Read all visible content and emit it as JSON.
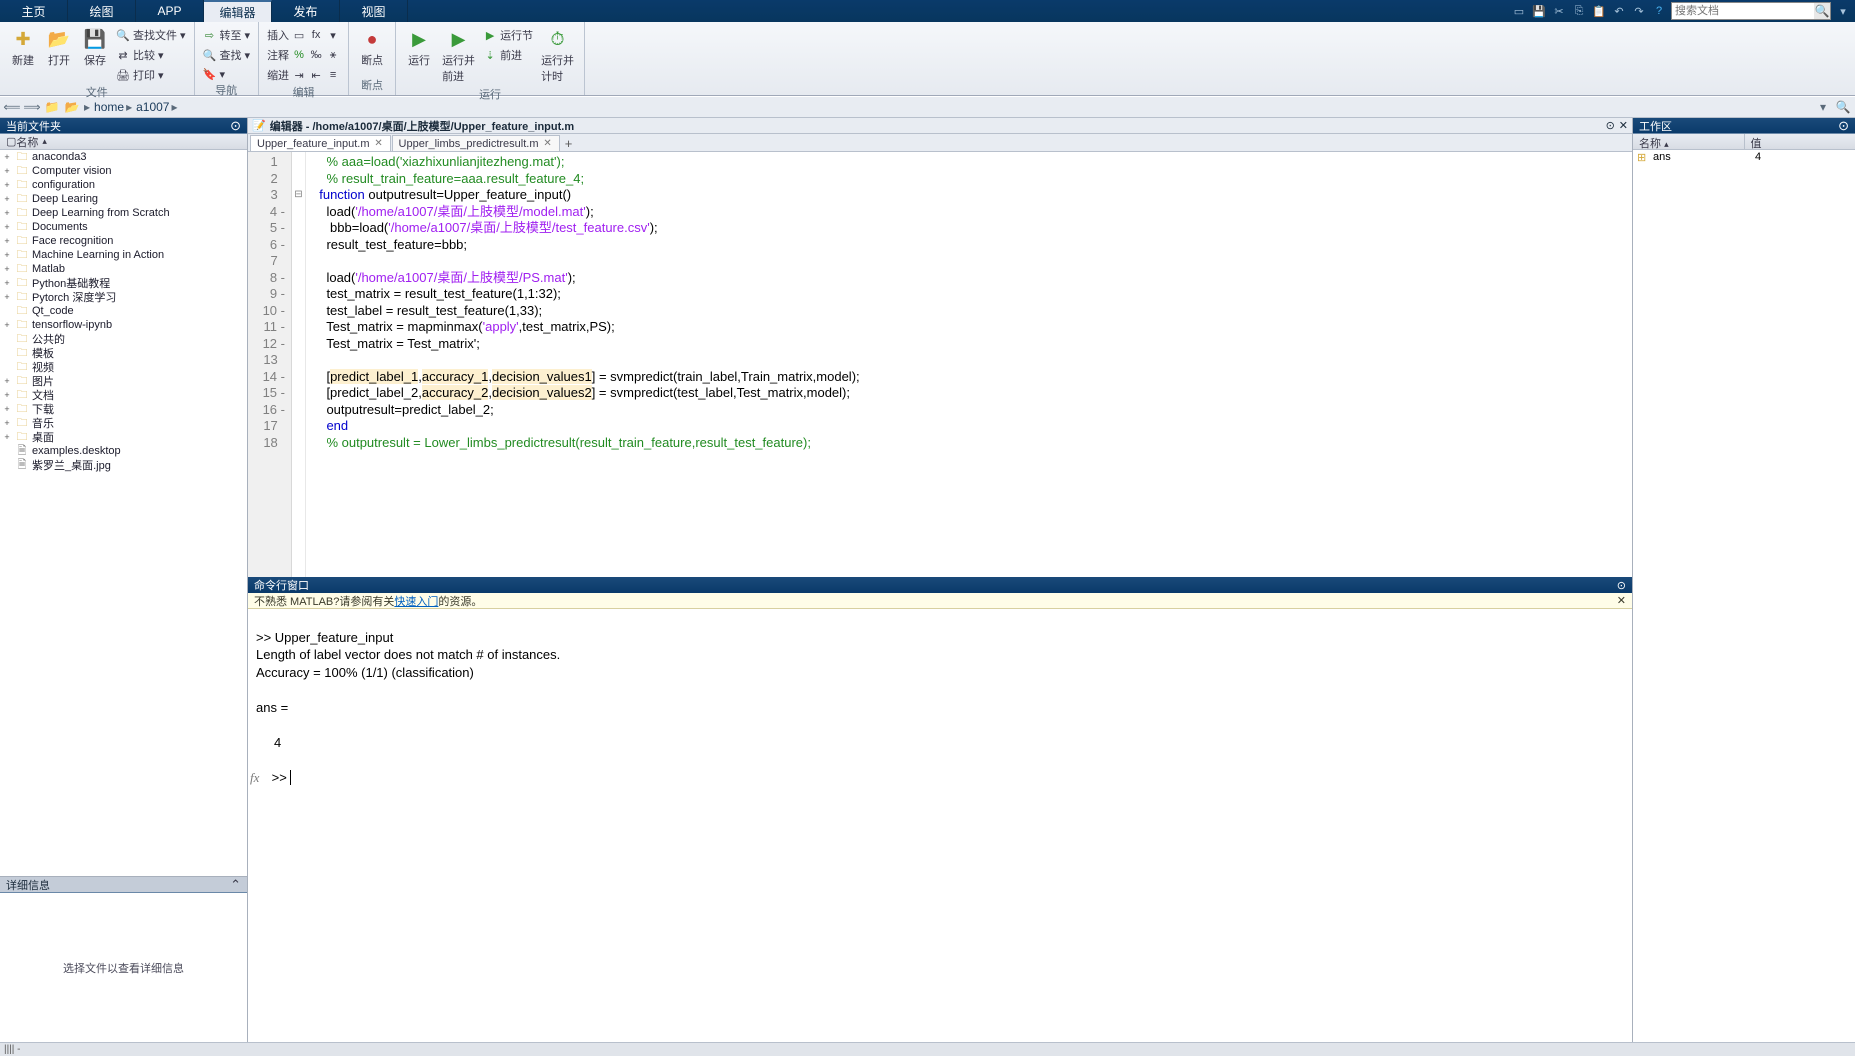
{
  "menu": {
    "tabs": [
      "主页",
      "绘图",
      "APP",
      "编辑器",
      "发布",
      "视图"
    ],
    "active_index": 3,
    "search_placeholder": "搜索文档"
  },
  "toolstrip": {
    "file": {
      "new": "新建",
      "open": "打开",
      "save": "保存",
      "find_files": "查找文件",
      "compare": "比较",
      "print": "打印",
      "label": "文件"
    },
    "nav": {
      "goto": "转至",
      "find": "查找",
      "bookmark": "",
      "label": "导航"
    },
    "edit": {
      "insert": "插入",
      "comment": "注释",
      "indent": "缩进",
      "label": "编辑"
    },
    "bp": {
      "breakpoints": "断点",
      "label": "断点"
    },
    "run": {
      "run": "运行",
      "run_advance": "运行并\n前进",
      "run_section": "运行节",
      "advance": "前进",
      "run_time": "运行并\n计时",
      "label": "运行"
    }
  },
  "address": {
    "parts": [
      "home",
      "a1007"
    ]
  },
  "current_folder": {
    "title": "当前文件夹",
    "name_col": "名称",
    "items": [
      {
        "t": "folder",
        "n": "anaconda3",
        "e": "+"
      },
      {
        "t": "folder",
        "n": "Computer vision",
        "e": "+"
      },
      {
        "t": "folder",
        "n": "configuration",
        "e": "+"
      },
      {
        "t": "folder",
        "n": "Deep Learing",
        "e": "+"
      },
      {
        "t": "folder",
        "n": "Deep Learning from Scratch",
        "e": "+"
      },
      {
        "t": "folder",
        "n": "Documents",
        "e": "+"
      },
      {
        "t": "folder",
        "n": "Face recognition",
        "e": "+"
      },
      {
        "t": "folder",
        "n": "Machine Learning in Action",
        "e": "+"
      },
      {
        "t": "folder",
        "n": "Matlab",
        "e": "+"
      },
      {
        "t": "folder",
        "n": "Python基础教程",
        "e": "+"
      },
      {
        "t": "folder",
        "n": "Pytorch 深度学习",
        "e": "+"
      },
      {
        "t": "folder",
        "n": "Qt_code",
        "e": ""
      },
      {
        "t": "folder",
        "n": "tensorflow-ipynb",
        "e": "+"
      },
      {
        "t": "folder",
        "n": "公共的",
        "e": ""
      },
      {
        "t": "folder",
        "n": "模板",
        "e": ""
      },
      {
        "t": "folder",
        "n": "视频",
        "e": ""
      },
      {
        "t": "folder",
        "n": "图片",
        "e": "+"
      },
      {
        "t": "folder",
        "n": "文档",
        "e": "+"
      },
      {
        "t": "folder",
        "n": "下载",
        "e": "+"
      },
      {
        "t": "folder",
        "n": "音乐",
        "e": "+"
      },
      {
        "t": "folder",
        "n": "桌面",
        "e": "+"
      },
      {
        "t": "file",
        "n": "examples.desktop",
        "e": ""
      },
      {
        "t": "file",
        "n": "紫罗兰_桌面.jpg",
        "e": ""
      }
    ]
  },
  "details": {
    "title": "详细信息",
    "empty": "选择文件以查看详细信息"
  },
  "editor": {
    "title_prefix": "编辑器 - ",
    "path": "/home/a1007/桌面/上肢模型/Upper_feature_input.m",
    "tabs": [
      {
        "label": "Upper_feature_input.m",
        "active": true
      },
      {
        "label": "Upper_limbs_predictresult.m",
        "active": false
      }
    ],
    "lines": [
      {
        "n": 1,
        "html": "    <span class='c-comment'>% aaa=load('xiazhixunlianjitezheng.mat');</span>"
      },
      {
        "n": 2,
        "html": "    <span class='c-comment'>% result_train_feature=aaa.result_feature_4;</span>"
      },
      {
        "n": 3,
        "fold": "⊟",
        "html": "  <span class='c-keyword'>function</span> outputresult=Upper_feature_input()"
      },
      {
        "n": 4,
        "dash": true,
        "html": "    load(<span class='c-string'>'/home/a1007/桌面/上肢模型/model.mat'</span>);"
      },
      {
        "n": 5,
        "dash": true,
        "html": "     bbb=load(<span class='c-string'>'/home/a1007/桌面/上肢模型/test_feature.csv'</span>);"
      },
      {
        "n": 6,
        "dash": true,
        "html": "    result_test_feature=bbb;"
      },
      {
        "n": 7,
        "html": ""
      },
      {
        "n": 8,
        "dash": true,
        "html": "    load(<span class='c-string'>'/home/a1007/桌面/上肢模型/PS.mat'</span>);"
      },
      {
        "n": 9,
        "dash": true,
        "html": "    test_matrix = result_test_feature(1,1:32);"
      },
      {
        "n": 10,
        "dash": true,
        "html": "    test_label = result_test_feature(1,33);"
      },
      {
        "n": 11,
        "dash": true,
        "html": "    Test_matrix = mapminmax(<span class='c-string'>'apply'</span>,test_matrix,PS);"
      },
      {
        "n": 12,
        "dash": true,
        "html": "    Test_matrix = Test_matrix';"
      },
      {
        "n": 13,
        "html": ""
      },
      {
        "n": 14,
        "dash": true,
        "html": "    [<span class='c-hl'>predict_label_1</span>,<span class='c-hl'>accuracy_1</span>,<span class='c-hl'>decision_values1</span>] = svmpredict(train_label,Train_matrix,model);"
      },
      {
        "n": 15,
        "dash": true,
        "html": "    [predict_label_2,<span class='c-hl'>accuracy_2</span>,<span class='c-hl'>decision_values2</span>] = svmpredict(test_label,Test_matrix,model);"
      },
      {
        "n": 16,
        "dash": true,
        "html": "    outputresult=predict_label_2;"
      },
      {
        "n": 17,
        "html": "    <span class='c-keyword'>end</span>"
      },
      {
        "n": 18,
        "html": "    <span class='c-comment'>% outputresult = Lower_limbs_predictresult(result_train_feature,result_test_feature);</span>"
      }
    ]
  },
  "command_window": {
    "title": "命令行窗口",
    "hint_prefix": "不熟悉 MATLAB?请参阅有关",
    "hint_link": "快速入门",
    "hint_suffix": "的资源。",
    "output": ">> Upper_feature_input\nLength of label vector does not match # of instances.\nAccuracy = 100% (1/1) (classification)\n\nans =\n\n     4\n\n",
    "prompt": ">> ",
    "fx": "fx"
  },
  "workspace": {
    "title": "工作区",
    "col_name": "名称",
    "col_value": "值",
    "vars": [
      {
        "name": "ans",
        "value": "4"
      }
    ]
  },
  "status": "|||| -"
}
